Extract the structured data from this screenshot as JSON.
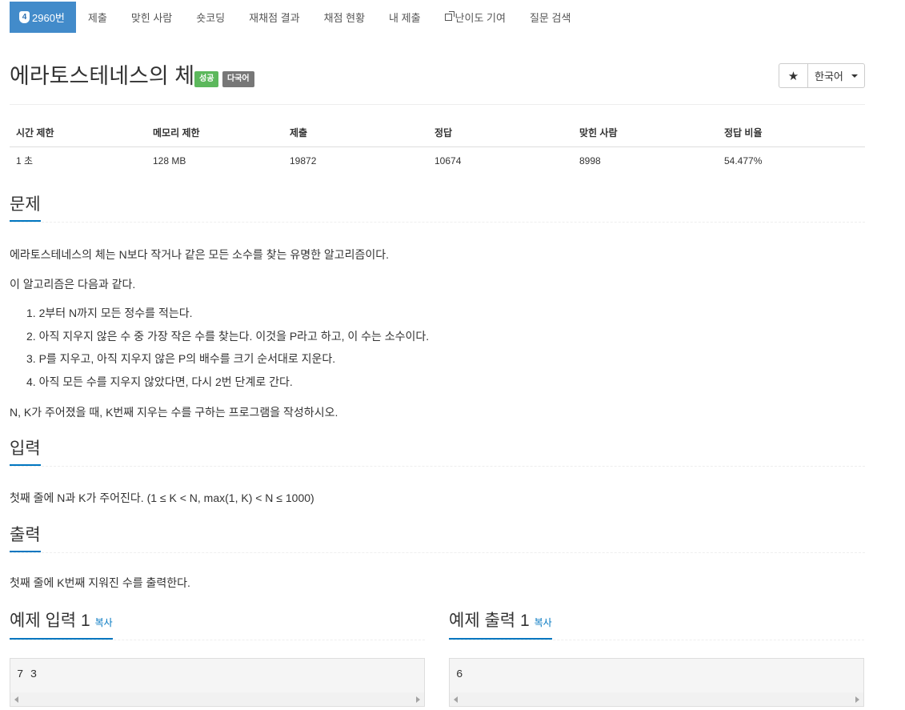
{
  "nav": {
    "problem_tab": {
      "tier": "4",
      "label": "2960번"
    },
    "items": [
      "제출",
      "맞힌 사람",
      "숏코딩",
      "재채점 결과",
      "채점 현황",
      "내 제출",
      "난이도 기여",
      "질문 검색"
    ]
  },
  "problem": {
    "title": "에라토스테네스의 체",
    "badge_success": "성공",
    "badge_lang": "다국어",
    "language_select": "한국어"
  },
  "info_table": {
    "headers": [
      "시간 제한",
      "메모리 제한",
      "제출",
      "정답",
      "맞힌 사람",
      "정답 비율"
    ],
    "values": [
      "1 초",
      "128 MB",
      "19872",
      "10674",
      "8998",
      "54.477%"
    ]
  },
  "sections": {
    "problem_heading": "문제",
    "input_heading": "입력",
    "output_heading": "출력",
    "sample_input_heading": "예제 입력 1",
    "sample_output_heading": "예제 출력 1",
    "copy_label": "복사"
  },
  "description": {
    "p1": "에라토스테네스의 체는 N보다 작거나 같은 모든 소수를 찾는 유명한 알고리즘이다.",
    "p2": "이 알고리즘은 다음과 같다.",
    "steps": [
      "2부터 N까지 모든 정수를 적는다.",
      "아직 지우지 않은 수 중 가장 작은 수를 찾는다. 이것을 P라고 하고, 이 수는 소수이다.",
      "P를 지우고, 아직 지우지 않은 P의 배수를 크기 순서대로 지운다.",
      "아직 모든 수를 지우지 않았다면, 다시 2번 단계로 간다."
    ],
    "step_numbers": [
      "1.",
      "2.",
      "3.",
      "4."
    ],
    "p3": "N, K가 주어졌을 때, K번째 지우는 수를 구하는 프로그램을 작성하시오."
  },
  "input_text": "첫째 줄에 N과 K가 주어진다. (1 ≤ K < N, max(1, K) < N ≤ 1000)",
  "output_text": "첫째 줄에 K번째 지워진 수를 출력한다.",
  "samples": {
    "input": "7 3",
    "output": "6"
  }
}
